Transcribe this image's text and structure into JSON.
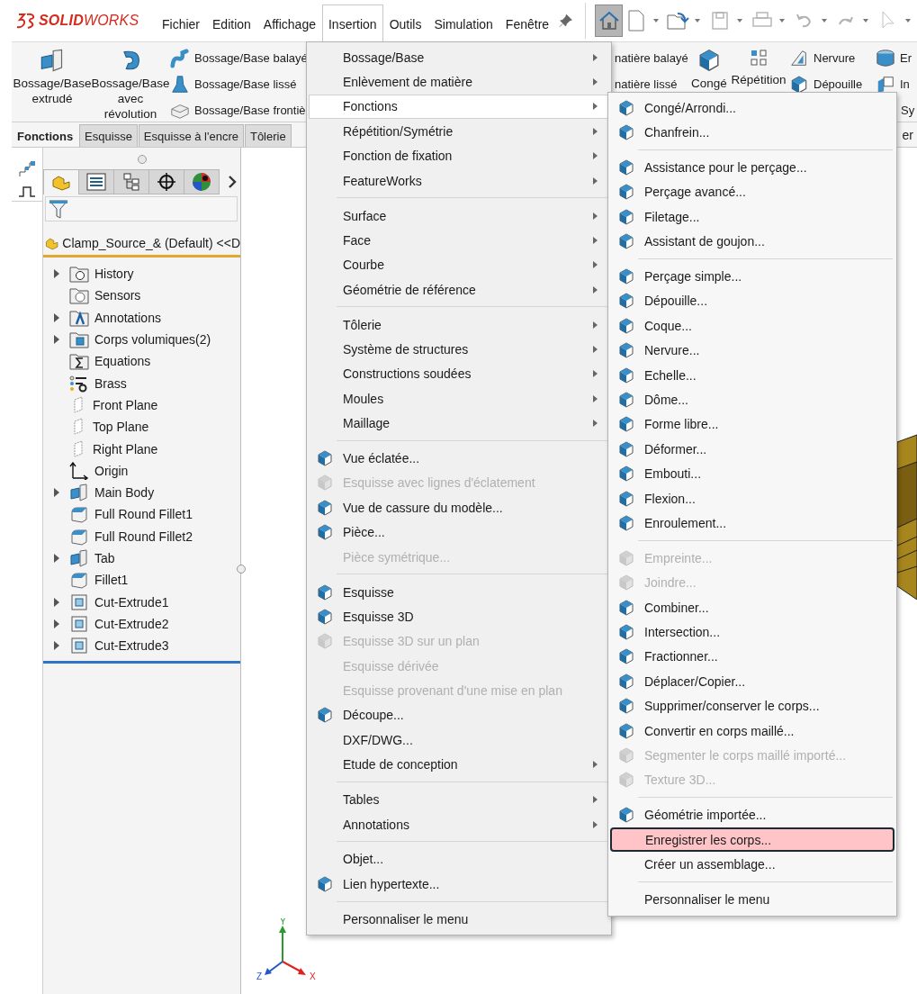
{
  "app": {
    "logo": "**SOLID**WORKS"
  },
  "menu_bar": [
    {
      "label": "Fichier",
      "selected": false
    },
    {
      "label": "Edition",
      "selected": false
    },
    {
      "label": "Affichage",
      "selected": false
    },
    {
      "label": "Insertion",
      "selected": true
    },
    {
      "label": "Outils",
      "selected": false
    },
    {
      "label": "Simulation",
      "selected": false
    },
    {
      "label": "Fenêtre",
      "selected": false
    }
  ],
  "quick_access": [
    {
      "kind": "home",
      "pressed": true,
      "disabled": false,
      "dropdown": false
    },
    {
      "kind": "new",
      "pressed": false,
      "disabled": false,
      "dropdown": true
    },
    {
      "kind": "open",
      "pressed": false,
      "disabled": false,
      "dropdown": true
    },
    {
      "kind": "save",
      "pressed": false,
      "disabled": true,
      "dropdown": true
    },
    {
      "kind": "print",
      "pressed": false,
      "disabled": true,
      "dropdown": true
    },
    {
      "kind": "undo",
      "pressed": false,
      "disabled": true,
      "dropdown": true
    },
    {
      "kind": "redo",
      "pressed": false,
      "disabled": true,
      "dropdown": true
    },
    {
      "kind": "select",
      "pressed": false,
      "disabled": true,
      "dropdown": true
    }
  ],
  "ribbon": {
    "left": [
      {
        "kind": "big",
        "label": "Bossage/Base extrudé"
      },
      {
        "kind": "big",
        "label": "Bossage/Base avec révolution"
      },
      {
        "kind": "stack",
        "items": [
          {
            "label": "Bossage/Base balayé"
          },
          {
            "label": "Bossage/Base lissé"
          },
          {
            "label": "Bossage/Base frontiè"
          }
        ]
      }
    ],
    "right": [
      {
        "kind": "stack",
        "items": [
          {
            "label": "natière balayé"
          },
          {
            "label": "natière lissé"
          }
        ]
      },
      {
        "kind": "big",
        "label": "Congé"
      },
      {
        "kind": "big",
        "label": "Répétition"
      },
      {
        "kind": "stack",
        "items": [
          {
            "label": "Nervure"
          },
          {
            "label": "Dépouille"
          }
        ]
      },
      {
        "kind": "stack",
        "items": [
          {
            "label": "Er"
          },
          {
            "label": "In"
          },
          {
            "label": "Sy"
          }
        ]
      }
    ]
  },
  "command_tabs": [
    {
      "label": "Fonctions",
      "selected": true
    },
    {
      "label": "Esquisse",
      "selected": false
    },
    {
      "label": "Esquisse à l'encre",
      "selected": false
    },
    {
      "label": "Tôlerie",
      "selected": false
    }
  ],
  "command_tabs_fragment": "er",
  "panel_tabs": [
    {
      "kind": "features",
      "selected": true
    },
    {
      "kind": "properties",
      "selected": false
    },
    {
      "kind": "configurations",
      "selected": false
    },
    {
      "kind": "dimxpert",
      "selected": false
    },
    {
      "kind": "display",
      "selected": false
    }
  ],
  "tree": {
    "root": "Clamp_Source_& (Default) <<D",
    "items": [
      {
        "label": "History",
        "kind": "history",
        "has_children": true
      },
      {
        "label": "Sensors",
        "kind": "sensor",
        "has_children": false
      },
      {
        "label": "Annotations",
        "kind": "annotation",
        "has_children": true
      },
      {
        "label": "Corps volumiques(2)",
        "kind": "bodies",
        "has_children": true
      },
      {
        "label": "Equations",
        "kind": "equation",
        "has_children": false
      },
      {
        "label": "Brass",
        "kind": "material",
        "has_children": false
      },
      {
        "label": "Front Plane",
        "kind": "plane",
        "has_children": false
      },
      {
        "label": "Top Plane",
        "kind": "plane",
        "has_children": false
      },
      {
        "label": "Right Plane",
        "kind": "plane",
        "has_children": false
      },
      {
        "label": "Origin",
        "kind": "origin",
        "has_children": false
      },
      {
        "label": "Main Body",
        "kind": "extrude",
        "has_children": true
      },
      {
        "label": "Full Round Fillet1",
        "kind": "fillet",
        "has_children": false
      },
      {
        "label": "Full Round Fillet2",
        "kind": "fillet",
        "has_children": false
      },
      {
        "label": "Tab",
        "kind": "extrude",
        "has_children": true
      },
      {
        "label": "Fillet1",
        "kind": "fillet",
        "has_children": false
      },
      {
        "label": "Cut-Extrude1",
        "kind": "cut",
        "has_children": true
      },
      {
        "label": "Cut-Extrude2",
        "kind": "cut",
        "has_children": true
      },
      {
        "label": "Cut-Extrude3",
        "kind": "cut",
        "has_children": true
      }
    ]
  },
  "triad": {
    "x": "X",
    "y": "Y",
    "z": "Z"
  },
  "insert_menu": [
    {
      "kind": "item",
      "label": "Bossage/Base",
      "submenu": true,
      "disabled": false,
      "selected": false,
      "icon": false
    },
    {
      "kind": "item",
      "label": "Enlèvement de matière",
      "submenu": true,
      "disabled": false,
      "selected": false,
      "icon": false
    },
    {
      "kind": "item",
      "label": "Fonctions",
      "submenu": true,
      "disabled": false,
      "selected": true,
      "icon": false
    },
    {
      "kind": "item",
      "label": "Répétition/Symétrie",
      "submenu": true,
      "disabled": false,
      "selected": false,
      "icon": false
    },
    {
      "kind": "item",
      "label": "Fonction de fixation",
      "submenu": true,
      "disabled": false,
      "selected": false,
      "icon": false
    },
    {
      "kind": "item",
      "label": "FeatureWorks",
      "submenu": true,
      "disabled": false,
      "selected": false,
      "icon": false
    },
    {
      "kind": "separator"
    },
    {
      "kind": "item",
      "label": "Surface",
      "submenu": true,
      "disabled": false,
      "selected": false,
      "icon": false
    },
    {
      "kind": "item",
      "label": "Face",
      "submenu": true,
      "disabled": false,
      "selected": false,
      "icon": false
    },
    {
      "kind": "item",
      "label": "Courbe",
      "submenu": true,
      "disabled": false,
      "selected": false,
      "icon": false
    },
    {
      "kind": "item",
      "label": "Géométrie de référence",
      "submenu": true,
      "disabled": false,
      "selected": false,
      "icon": false
    },
    {
      "kind": "separator"
    },
    {
      "kind": "item",
      "label": "Tôlerie",
      "submenu": true,
      "disabled": false,
      "selected": false,
      "icon": false
    },
    {
      "kind": "item",
      "label": "Système de structures",
      "submenu": true,
      "disabled": false,
      "selected": false,
      "icon": false
    },
    {
      "kind": "item",
      "label": "Constructions soudées",
      "submenu": true,
      "disabled": false,
      "selected": false,
      "icon": false
    },
    {
      "kind": "item",
      "label": "Moules",
      "submenu": true,
      "disabled": false,
      "selected": false,
      "icon": false
    },
    {
      "kind": "item",
      "label": "Maillage",
      "submenu": true,
      "disabled": false,
      "selected": false,
      "icon": false
    },
    {
      "kind": "separator"
    },
    {
      "kind": "item",
      "label": "Vue éclatée...",
      "submenu": false,
      "disabled": false,
      "selected": false,
      "icon": true
    },
    {
      "kind": "item",
      "label": "Esquisse avec lignes d'éclatement",
      "submenu": false,
      "disabled": true,
      "selected": false,
      "icon": true
    },
    {
      "kind": "item",
      "label": "Vue de cassure du modèle...",
      "submenu": false,
      "disabled": false,
      "selected": false,
      "icon": true
    },
    {
      "kind": "item",
      "label": "Pièce...",
      "submenu": false,
      "disabled": false,
      "selected": false,
      "icon": true
    },
    {
      "kind": "item",
      "label": "Pièce symétrique...",
      "submenu": false,
      "disabled": true,
      "selected": false,
      "icon": false
    },
    {
      "kind": "separator"
    },
    {
      "kind": "item",
      "label": "Esquisse",
      "submenu": false,
      "disabled": false,
      "selected": false,
      "icon": true
    },
    {
      "kind": "item",
      "label": "Esquisse 3D",
      "submenu": false,
      "disabled": false,
      "selected": false,
      "icon": true
    },
    {
      "kind": "item",
      "label": "Esquisse 3D sur un plan",
      "submenu": false,
      "disabled": true,
      "selected": false,
      "icon": true
    },
    {
      "kind": "item",
      "label": "Esquisse dérivée",
      "submenu": false,
      "disabled": true,
      "selected": false,
      "icon": false
    },
    {
      "kind": "item",
      "label": "Esquisse provenant d'une mise en plan",
      "submenu": false,
      "disabled": true,
      "selected": false,
      "icon": false
    },
    {
      "kind": "item",
      "label": "Découpe...",
      "submenu": false,
      "disabled": false,
      "selected": false,
      "icon": true
    },
    {
      "kind": "item",
      "label": "DXF/DWG...",
      "submenu": false,
      "disabled": false,
      "selected": false,
      "icon": false
    },
    {
      "kind": "item",
      "label": "Etude de conception",
      "submenu": true,
      "disabled": false,
      "selected": false,
      "icon": false
    },
    {
      "kind": "separator"
    },
    {
      "kind": "item",
      "label": "Tables",
      "submenu": true,
      "disabled": false,
      "selected": false,
      "icon": false
    },
    {
      "kind": "item",
      "label": "Annotations",
      "submenu": true,
      "disabled": false,
      "selected": false,
      "icon": false
    },
    {
      "kind": "separator"
    },
    {
      "kind": "item",
      "label": "Objet...",
      "submenu": false,
      "disabled": false,
      "selected": false,
      "icon": false
    },
    {
      "kind": "item",
      "label": "Lien hypertexte...",
      "submenu": false,
      "disabled": false,
      "selected": false,
      "icon": true
    },
    {
      "kind": "separator"
    },
    {
      "kind": "item",
      "label": "Personnaliser le menu",
      "submenu": false,
      "disabled": false,
      "selected": false,
      "icon": false
    }
  ],
  "features_menu": [
    {
      "kind": "item",
      "label": "Congé/Arrondi...",
      "disabled": false,
      "selected": false,
      "icon": true
    },
    {
      "kind": "item",
      "label": "Chanfrein...",
      "disabled": false,
      "selected": false,
      "icon": true
    },
    {
      "kind": "separator"
    },
    {
      "kind": "item",
      "label": "Assistance pour le perçage...",
      "disabled": false,
      "selected": false,
      "icon": true
    },
    {
      "kind": "item",
      "label": "Perçage avancé...",
      "disabled": false,
      "selected": false,
      "icon": true
    },
    {
      "kind": "item",
      "label": "Filetage...",
      "disabled": false,
      "selected": false,
      "icon": true
    },
    {
      "kind": "item",
      "label": "Assistant de goujon...",
      "disabled": false,
      "selected": false,
      "icon": true
    },
    {
      "kind": "separator"
    },
    {
      "kind": "item",
      "label": "Perçage simple...",
      "disabled": false,
      "selected": false,
      "icon": true
    },
    {
      "kind": "item",
      "label": "Dépouille...",
      "disabled": false,
      "selected": false,
      "icon": true
    },
    {
      "kind": "item",
      "label": "Coque...",
      "disabled": false,
      "selected": false,
      "icon": true
    },
    {
      "kind": "item",
      "label": "Nervure...",
      "disabled": false,
      "selected": false,
      "icon": true
    },
    {
      "kind": "item",
      "label": "Echelle...",
      "disabled": false,
      "selected": false,
      "icon": true
    },
    {
      "kind": "item",
      "label": "Dôme...",
      "disabled": false,
      "selected": false,
      "icon": true
    },
    {
      "kind": "item",
      "label": "Forme libre...",
      "disabled": false,
      "selected": false,
      "icon": true
    },
    {
      "kind": "item",
      "label": "Déformer...",
      "disabled": false,
      "selected": false,
      "icon": true
    },
    {
      "kind": "item",
      "label": "Embouti...",
      "disabled": false,
      "selected": false,
      "icon": true
    },
    {
      "kind": "item",
      "label": "Flexion...",
      "disabled": false,
      "selected": false,
      "icon": true
    },
    {
      "kind": "item",
      "label": "Enroulement...",
      "disabled": false,
      "selected": false,
      "icon": true
    },
    {
      "kind": "separator"
    },
    {
      "kind": "item",
      "label": "Empreinte...",
      "disabled": true,
      "selected": false,
      "icon": true
    },
    {
      "kind": "item",
      "label": "Joindre...",
      "disabled": true,
      "selected": false,
      "icon": true
    },
    {
      "kind": "item",
      "label": "Combiner...",
      "disabled": false,
      "selected": false,
      "icon": true
    },
    {
      "kind": "item",
      "label": "Intersection...",
      "disabled": false,
      "selected": false,
      "icon": true
    },
    {
      "kind": "item",
      "label": "Fractionner...",
      "disabled": false,
      "selected": false,
      "icon": true
    },
    {
      "kind": "item",
      "label": "Déplacer/Copier...",
      "disabled": false,
      "selected": false,
      "icon": true
    },
    {
      "kind": "item",
      "label": "Supprimer/conserver le corps...",
      "disabled": false,
      "selected": false,
      "icon": true
    },
    {
      "kind": "item",
      "label": "Convertir en corps maillé...",
      "disabled": false,
      "selected": false,
      "icon": true
    },
    {
      "kind": "item",
      "label": "Segmenter le corps maillé importé...",
      "disabled": true,
      "selected": false,
      "icon": true
    },
    {
      "kind": "item",
      "label": "Texture 3D...",
      "disabled": true,
      "selected": false,
      "icon": true
    },
    {
      "kind": "separator"
    },
    {
      "kind": "item",
      "label": "Géométrie importée...",
      "disabled": false,
      "selected": false,
      "icon": true
    },
    {
      "kind": "item",
      "label": "Enregistrer les corps...",
      "disabled": false,
      "selected": true,
      "icon": false
    },
    {
      "kind": "item",
      "label": "Créer un assemblage...",
      "disabled": false,
      "selected": false,
      "icon": false
    },
    {
      "kind": "separator"
    },
    {
      "kind": "item",
      "label": "Personnaliser le menu",
      "disabled": false,
      "selected": false,
      "icon": false
    }
  ]
}
